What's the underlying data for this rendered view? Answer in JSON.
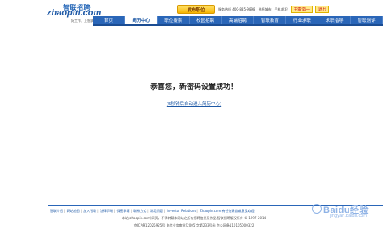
{
  "header": {
    "logo_cn": "智联招聘",
    "logo_en": "zhaopin.com",
    "logo_slogan": "好工作，上智联招聘",
    "post_job": "发布职位",
    "hotline": "服务热线 400-885-9898",
    "city": "选择城市",
    "mobile": "手机求职",
    "login_user": "王雷·软一",
    "logout": "退出"
  },
  "nav": {
    "items": [
      {
        "label": "首页",
        "active": false
      },
      {
        "label": "简历中心",
        "active": true
      },
      {
        "label": "职位搜索",
        "active": false
      },
      {
        "label": "校园招聘",
        "active": false
      },
      {
        "label": "高端招聘",
        "active": false
      },
      {
        "label": "智联教育",
        "active": false
      },
      {
        "label": "行业求职",
        "active": false
      },
      {
        "label": "求职指导",
        "active": false
      },
      {
        "label": "智联测评",
        "active": false
      }
    ]
  },
  "main": {
    "title": "恭喜您，新密码设置成功！",
    "redirect_link": "(5秒钟后自动进入简历中心)"
  },
  "footer": {
    "links": [
      "智联介绍",
      "网站地图",
      "加入智联",
      "法律声明",
      "保密承诺",
      "联系方式",
      "常见问题",
      "Investor Relations"
    ],
    "links_tail": "Zhaopin.com 有任何建议或意见欢迎",
    "copyright": "本站(zhaopin.com)网页，不得转载本网站之所有招聘信息及作品 智联招聘版权所有 © 1997-2014",
    "icp": "京ICP备12025925号 电信业务审批[2005]字第233号函 京公网备110105000322"
  },
  "watermark": {
    "text": "Baidu经验",
    "sub": "jingyan.baidu.com"
  }
}
